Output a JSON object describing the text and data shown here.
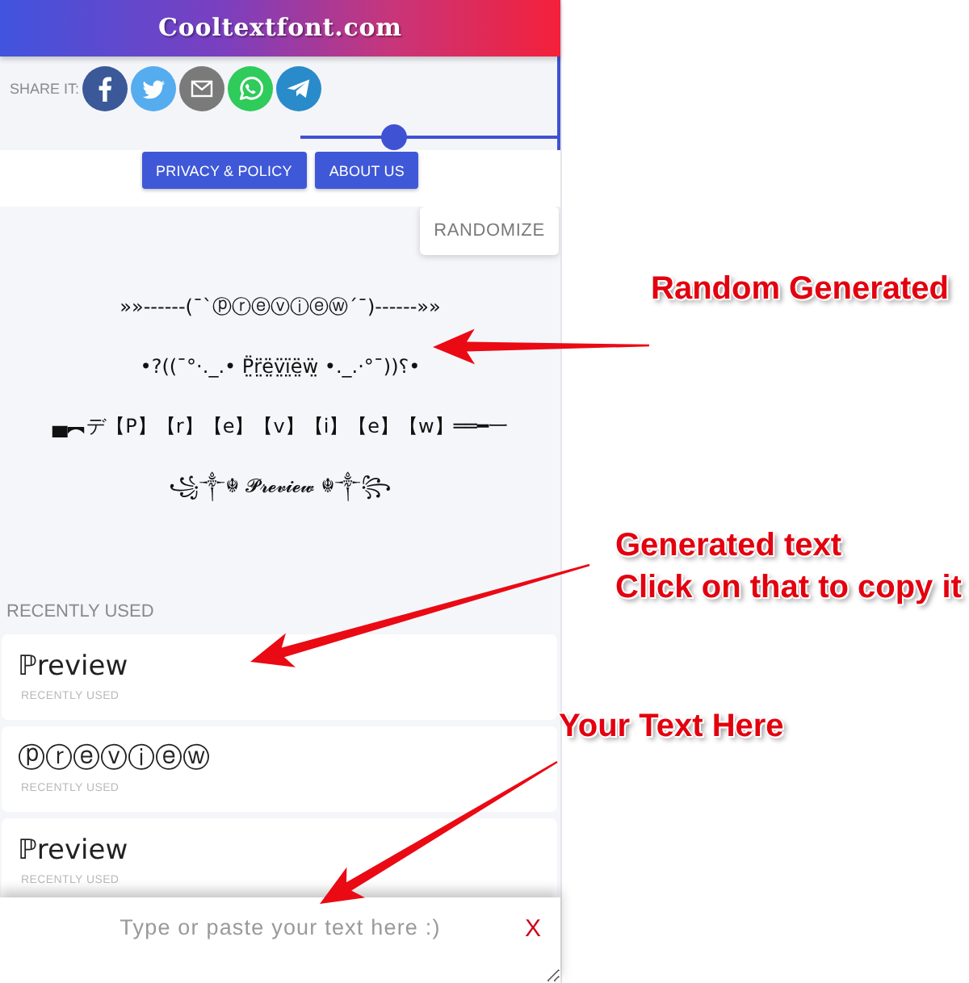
{
  "header": {
    "title": "Cooltextfont.com"
  },
  "share": {
    "label": "SHARE IT:",
    "buttons": [
      {
        "kind": "facebook"
      },
      {
        "kind": "twitter"
      },
      {
        "kind": "email"
      },
      {
        "kind": "whatsapp"
      },
      {
        "kind": "telegram"
      }
    ]
  },
  "slider": {
    "level": 0.36
  },
  "links": [
    "PRIVACY & POLICY",
    "ABOUT US"
  ],
  "randomize_button": "RANDOMIZE",
  "generated": [
    "»»------(¯`ⓟⓡⓔⓥⓘⓔⓦ´¯)------»»",
    "•?((¯°·._.• P̤̈r̤̈ë̤v̤̈ï̤ë̤ẅ̤ •._.·°¯))؟•",
    "▄︻デ【P】【r】【e】【v】【i】【e】【w】══━一",
    "꧁༒☬ 𝓟𝓻𝓮𝓿𝓲𝓮𝔀 ☬༒꧂"
  ],
  "recently_used": {
    "title": "RECENTLY USED",
    "items": [
      {
        "text": "ℙreview",
        "caption": "RECENTLY USED"
      },
      {
        "text": "ⓟⓡⓔⓥⓘⓔⓦ",
        "caption": "RECENTLY USED"
      },
      {
        "text": "ℙreview",
        "caption": "RECENTLY USED"
      }
    ]
  },
  "text_input": {
    "placeholder": "Type or paste your text here :)",
    "clear_button": "X"
  },
  "annotations": [
    {
      "text": "Random Generated"
    },
    {
      "text": "Generated text\nClick on that to copy it"
    },
    {
      "text": "Your Text Here"
    }
  ]
}
